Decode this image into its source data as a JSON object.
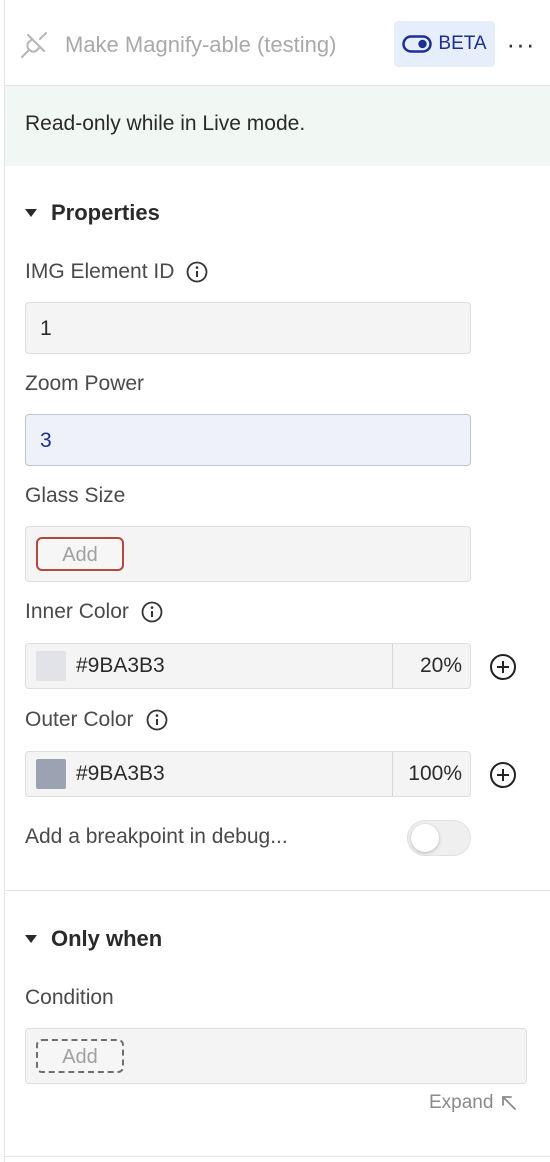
{
  "header": {
    "title": "Make Magnify-able (testing)",
    "beta_label": "BETA",
    "more_label": "···"
  },
  "notice": "Read-only while in Live mode.",
  "properties": {
    "heading": "Properties",
    "img_element_id": {
      "label": "IMG Element ID",
      "value": "1"
    },
    "zoom_power": {
      "label": "Zoom Power",
      "value": "3"
    },
    "glass_size": {
      "label": "Glass Size",
      "add_label": "Add"
    },
    "inner_color": {
      "label": "Inner Color",
      "hex": "#9BA3B3",
      "opacity": "20%",
      "swatch": "#e2e3e8"
    },
    "outer_color": {
      "label": "Outer Color",
      "hex": "#9BA3B3",
      "opacity": "100%",
      "swatch": "#9ba3b3"
    },
    "breakpoint": {
      "label": "Add a breakpoint in debug...",
      "enabled": false
    }
  },
  "only_when": {
    "heading": "Only when",
    "condition": {
      "label": "Condition",
      "add_label": "Add"
    },
    "expand_label": "Expand"
  },
  "icons": [
    "plug-icon",
    "toggle-icon",
    "more-icon",
    "info-icon",
    "plus-circle-icon",
    "caret-down-icon",
    "expand-arrow-icon"
  ]
}
